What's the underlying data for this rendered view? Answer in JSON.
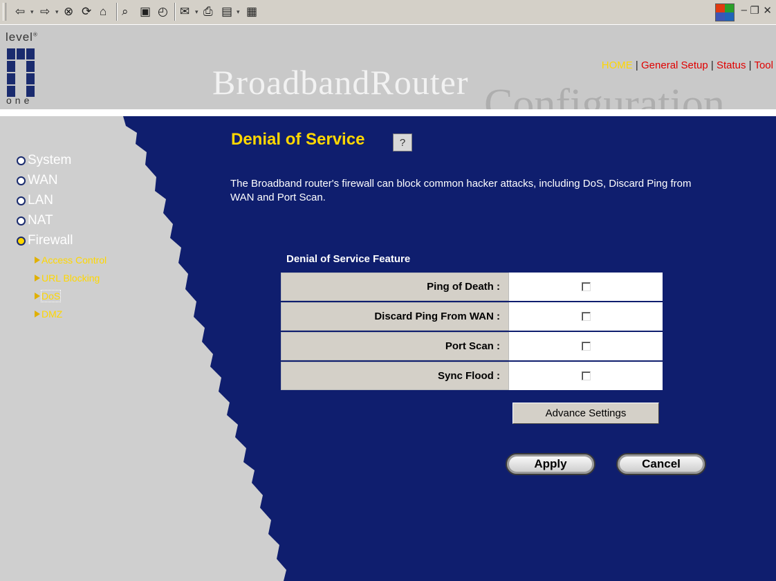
{
  "toolbar": {
    "icons": [
      "back-icon",
      "forward-icon",
      "stop-icon",
      "refresh-icon",
      "home-icon",
      "search-icon",
      "favorites-icon",
      "history-icon",
      "mail-icon",
      "print-icon",
      "edit-icon",
      "discuss-icon"
    ]
  },
  "header": {
    "logo_top": "level",
    "logo_bottom": "one",
    "brand": "BroadbandRouter",
    "subtitle": "Configuration",
    "nav": [
      "HOME",
      "General Setup",
      "Status",
      "Tool"
    ]
  },
  "sidebar": {
    "items": [
      "System",
      "WAN",
      "LAN",
      "NAT",
      "Firewall"
    ],
    "subitems": [
      "Access Control",
      "URL Blocking",
      "DoS",
      "DMZ"
    ]
  },
  "page": {
    "title": "Denial of Service",
    "description": "The Broadband router's firewall can block common hacker attacks, including DoS, Discard Ping from WAN and Port Scan.",
    "feature_heading": "Denial of Service Feature",
    "features": [
      "Ping of Death :",
      "Discard Ping From WAN :",
      "Port Scan :",
      "Sync Flood :"
    ],
    "advance_button": "Advance Settings",
    "apply_button": "Apply",
    "cancel_button": "Cancel"
  },
  "colors": {
    "background_main": "#0f1e6e",
    "title": "#ffd700",
    "nav_link": "#e00000"
  }
}
